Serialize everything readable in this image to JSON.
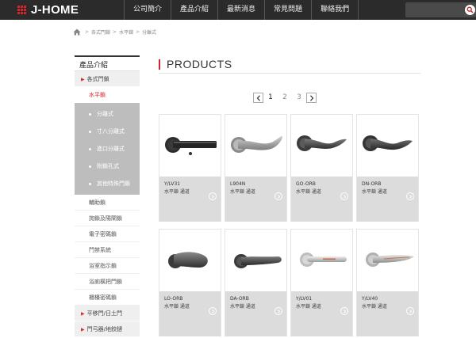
{
  "header": {
    "logo": "J-HOME",
    "nav": [
      "公司簡介",
      "產品介紹",
      "最新消息",
      "常見問題",
      "聯絡我們"
    ],
    "search_placeholder": ""
  },
  "breadcrumb": [
    "各式門鎖",
    "水平鎖",
    "分離式"
  ],
  "sidebar": {
    "title": "產品介紹",
    "category": "各式門鎖",
    "active_sub": "水平鎖",
    "leaves": [
      "分離式",
      "寸八分離式",
      "進口分離式",
      "附鎖孔式",
      "其他特殊門鎖"
    ],
    "others": [
      "輔助鎖",
      "詢鎖及陽閘鎖",
      "電子密碼鎖",
      "門禁系統",
      "浴室指示鎖",
      "浴廁橫把門鎖",
      "櫃檯密碼鎖"
    ],
    "category2": "平移門/日土門",
    "category3": "門弓器/地鉸鏈"
  },
  "main": {
    "title": "PRODUCTS",
    "pages": [
      "1",
      "2",
      "3"
    ],
    "current_page": "1"
  },
  "products": [
    {
      "model": "Y/LV31",
      "desc": "水平鎖 通道",
      "style": "flat-black"
    },
    {
      "model": "L904N",
      "desc": "水平鎖 通道",
      "style": "wave-satin"
    },
    {
      "model": "GO-ORB",
      "desc": "水平鎖 通道",
      "style": "curl-bronze"
    },
    {
      "model": "DN-ORB",
      "desc": "水平鎖 通道",
      "style": "curl-bronze"
    },
    {
      "model": "LO-ORB",
      "desc": "水平鎖 通道",
      "style": "knob-bronze"
    },
    {
      "model": "DA-ORB",
      "desc": "水平鎖 通道",
      "style": "bar-bronze"
    },
    {
      "model": "Y/LV01",
      "desc": "水平鎖 通道",
      "style": "tube-satin"
    },
    {
      "model": "Y/LV40",
      "desc": "水平鎖 通道",
      "style": "wing-satin"
    }
  ],
  "colors": {
    "accent": "#d8232a",
    "topbar": "#2b2b2b",
    "card_info": "#dcdcdc",
    "sidebar_group": "#bdbdbd"
  }
}
